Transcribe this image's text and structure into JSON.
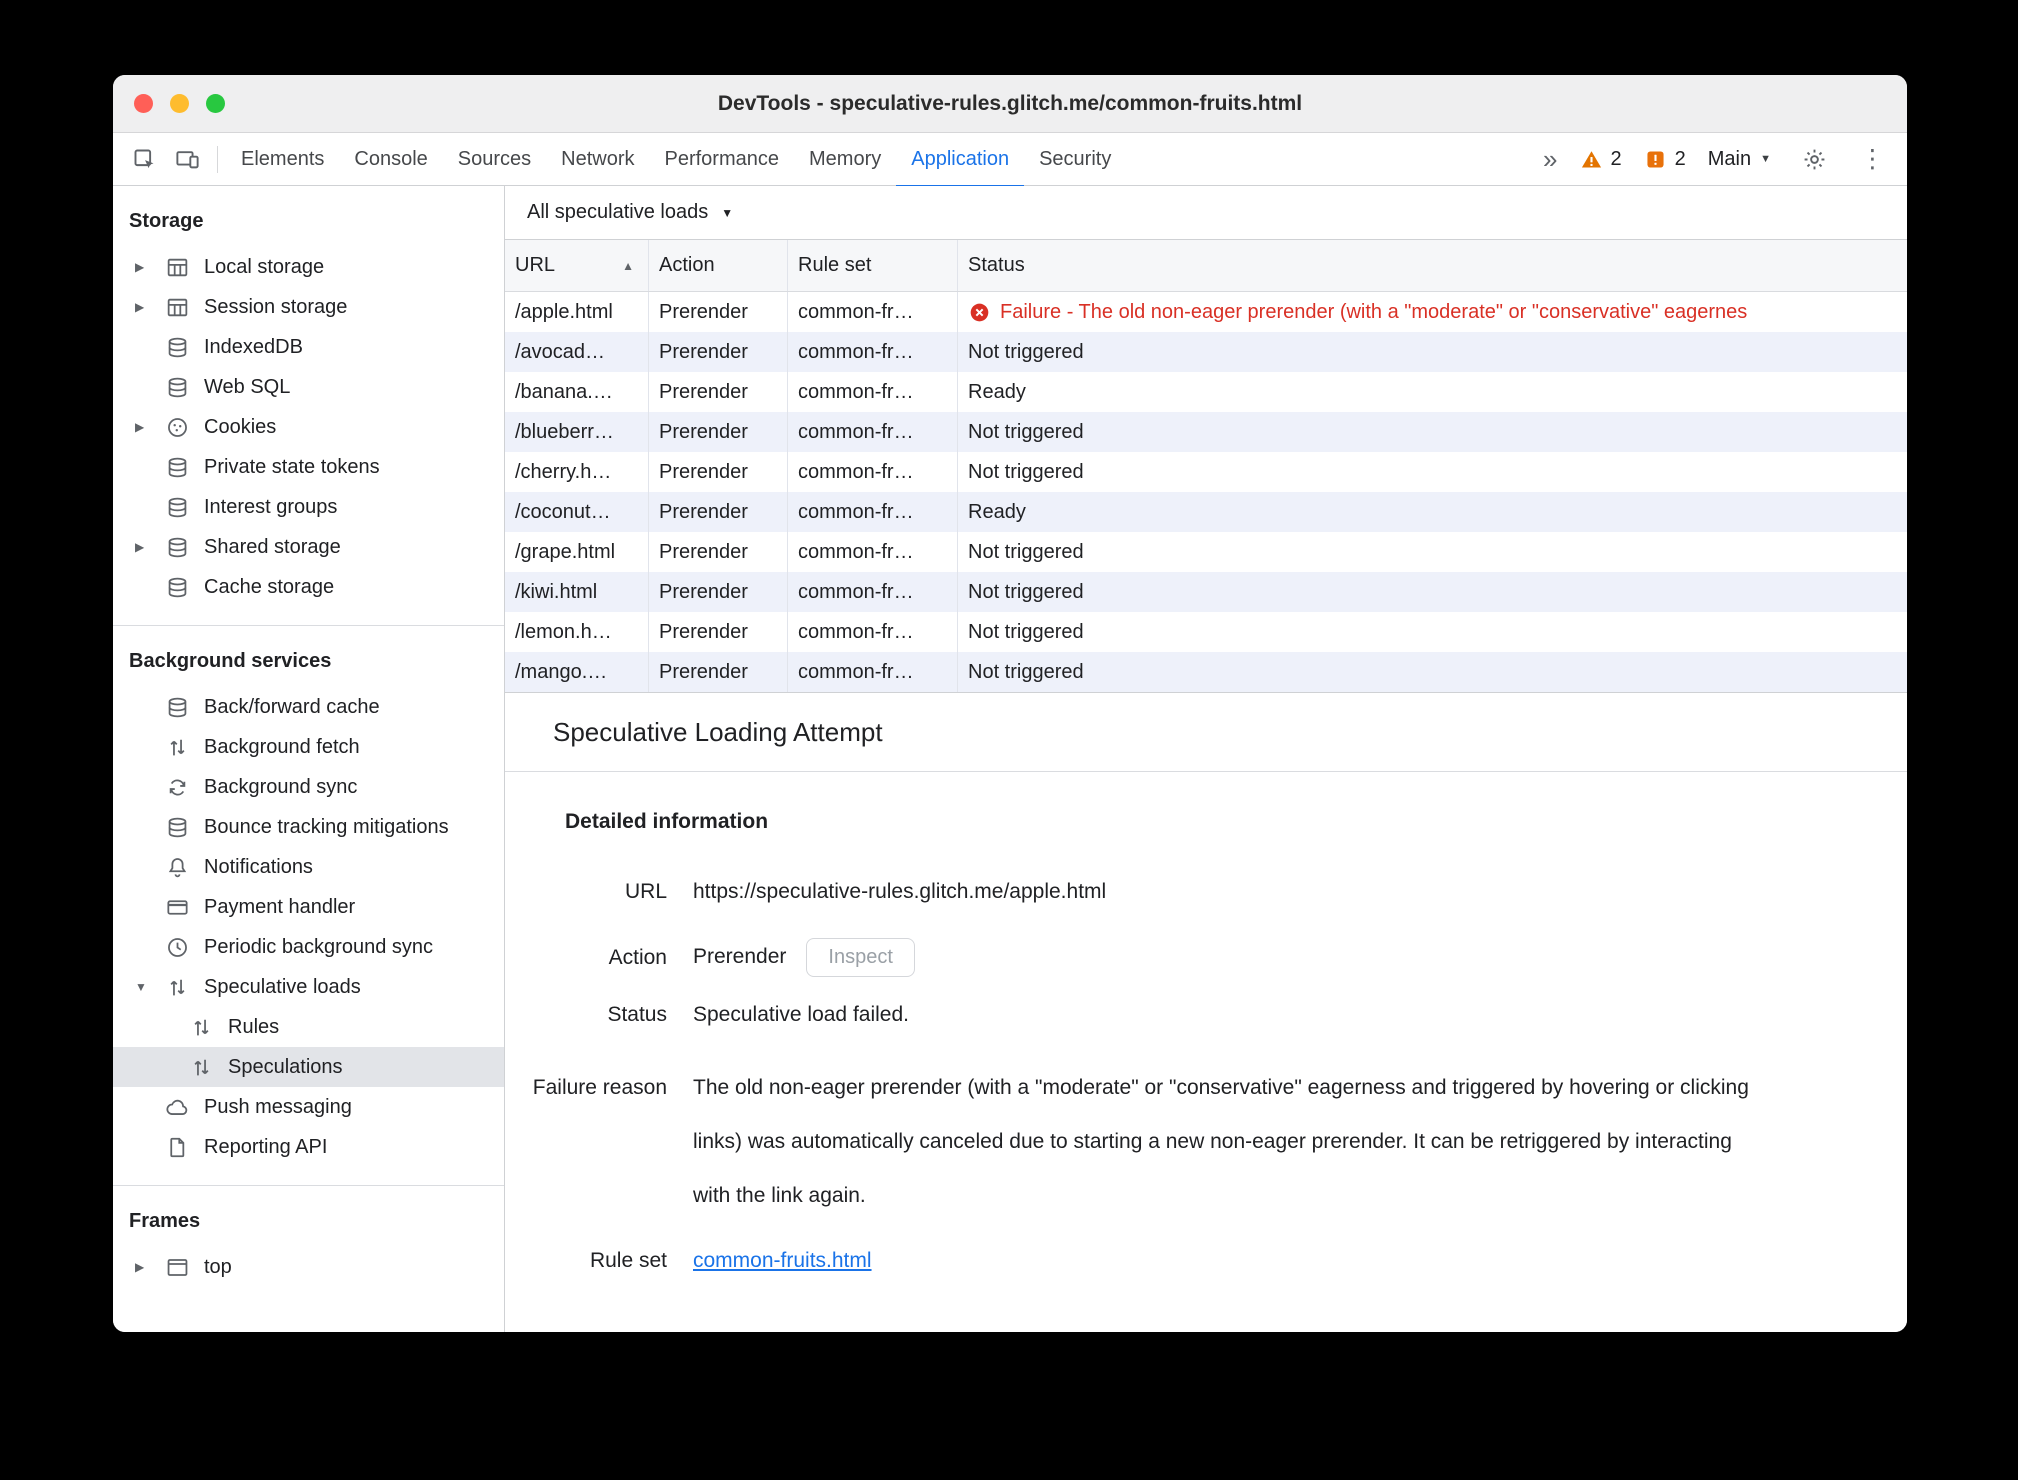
{
  "window": {
    "title": "DevTools - speculative-rules.glitch.me/common-fruits.html"
  },
  "icons": {
    "more_tabs": "»",
    "overflow_menu": "⋮",
    "dropdown_arrow": "▼",
    "expand_closed": "▶",
    "expand_open": "▼",
    "sort_ascending": "▲"
  },
  "toolbar": {
    "tabs": [
      "Elements",
      "Console",
      "Sources",
      "Network",
      "Performance",
      "Memory",
      "Application",
      "Security"
    ],
    "active_tab": "Application",
    "warning_count": "2",
    "issue_count": "2",
    "main_label": "Main"
  },
  "sidebar": {
    "storage": {
      "title": "Storage",
      "items": [
        "Local storage",
        "Session storage",
        "IndexedDB",
        "Web SQL",
        "Cookies",
        "Private state tokens",
        "Interest groups",
        "Shared storage",
        "Cache storage"
      ]
    },
    "background_services": {
      "title": "Background services",
      "items": [
        "Back/forward cache",
        "Background fetch",
        "Background sync",
        "Bounce tracking mitigations",
        "Notifications",
        "Payment handler",
        "Periodic background sync",
        "Speculative loads",
        "Rules",
        "Speculations",
        "Push messaging",
        "Reporting API"
      ],
      "selected": "Speculations"
    },
    "frames": {
      "title": "Frames",
      "items": [
        "top"
      ]
    }
  },
  "main": {
    "filter_label": "All speculative loads",
    "table": {
      "headers": [
        "URL",
        "Action",
        "Rule set",
        "Status"
      ],
      "rows": [
        {
          "url": "/apple.html",
          "action": "Prerender",
          "rule_set": "common-fr…",
          "status": "Failure - The old non-eager prerender (with a \"moderate\" or \"conservative\" eagernes"
        },
        {
          "url": "/avocad…",
          "action": "Prerender",
          "rule_set": "common-fr…",
          "status": "Not triggered"
        },
        {
          "url": "/banana.…",
          "action": "Prerender",
          "rule_set": "common-fr…",
          "status": "Ready"
        },
        {
          "url": "/blueberr…",
          "action": "Prerender",
          "rule_set": "common-fr…",
          "status": "Not triggered"
        },
        {
          "url": "/cherry.h…",
          "action": "Prerender",
          "rule_set": "common-fr…",
          "status": "Not triggered"
        },
        {
          "url": "/coconut…",
          "action": "Prerender",
          "rule_set": "common-fr…",
          "status": "Ready"
        },
        {
          "url": "/grape.html",
          "action": "Prerender",
          "rule_set": "common-fr…",
          "status": "Not triggered"
        },
        {
          "url": "/kiwi.html",
          "action": "Prerender",
          "rule_set": "common-fr…",
          "status": "Not triggered"
        },
        {
          "url": "/lemon.h…",
          "action": "Prerender",
          "rule_set": "common-fr…",
          "status": "Not triggered"
        },
        {
          "url": "/mango.…",
          "action": "Prerender",
          "rule_set": "common-fr…",
          "status": "Not triggered"
        }
      ]
    },
    "detail": {
      "heading": "Speculative Loading Attempt",
      "subheading": "Detailed information",
      "url_label": "URL",
      "url_value": "https://speculative-rules.glitch.me/apple.html",
      "action_label": "Action",
      "action_value": "Prerender",
      "inspect_button": "Inspect",
      "status_label": "Status",
      "status_value": "Speculative load failed.",
      "failure_label": "Failure reason",
      "failure_value": "The old non-eager prerender (with a \"moderate\" or \"conservative\" eagerness and triggered by hovering or clicking links) was automatically canceled due to starting a new non-eager prerender. It can be retriggered by interacting with the link again.",
      "rule_set_label": "Rule set",
      "rule_set_value": "common-fruits.html"
    }
  },
  "colors": {
    "accent": "#1a73e8",
    "failure": "#d93025"
  }
}
